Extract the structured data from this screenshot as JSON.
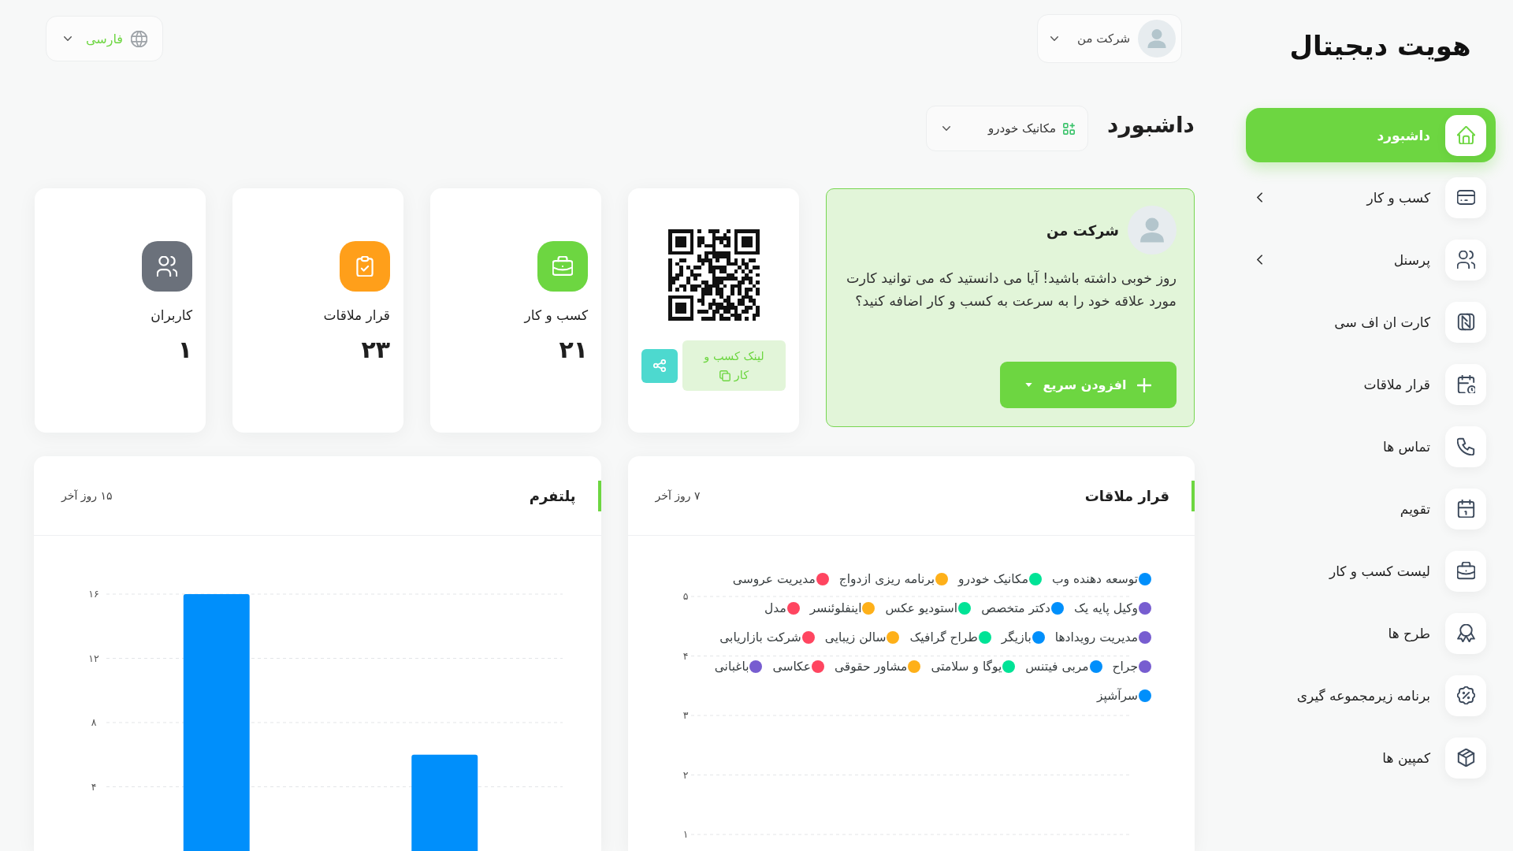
{
  "sidebar": {
    "logo": "هویت دیجیتال",
    "items": [
      {
        "label": "داشبورد",
        "selected": true,
        "kind": "link"
      },
      {
        "label": "کسب و کار",
        "selected": false,
        "kind": "group"
      },
      {
        "label": "پرسنل",
        "selected": false,
        "kind": "group"
      },
      {
        "label": "کارت ان اف سی",
        "selected": false,
        "kind": "link"
      },
      {
        "label": "قرار ملاقات",
        "selected": false,
        "kind": "link"
      },
      {
        "label": "تماس ها",
        "selected": false,
        "kind": "link"
      },
      {
        "label": "تقویم",
        "selected": false,
        "kind": "link"
      },
      {
        "label": "لیست کسب و کار",
        "selected": false,
        "kind": "link"
      },
      {
        "label": "طرح ها",
        "selected": false,
        "kind": "link"
      },
      {
        "label": "برنامه زیرمجموعه گیری",
        "selected": false,
        "kind": "link"
      },
      {
        "label": "کمپین ها",
        "selected": false,
        "kind": "link"
      }
    ]
  },
  "top_bar": {
    "account": {
      "name": "شرکت من"
    },
    "language": {
      "label": "فارسی"
    }
  },
  "page_header": {
    "title": "داشبورد",
    "category": "مکانیک خودرو"
  },
  "welcome_card": {
    "name": "شرکت من",
    "message": "روز خوبی داشته باشید! آیا می دانستید که می توانید کارت مورد علاقه خود را به سرعت به کسب و کار اضافه کنید؟",
    "button": "افزودن سریع"
  },
  "qr_card": {
    "link_label": "لینک کسب و کار"
  },
  "stats": [
    {
      "label": "کسب و کار",
      "value": "۲۱",
      "color": "#6dd641"
    },
    {
      "label": "قرار ملاقات",
      "value": "۲۳",
      "color": "#ff9f1a"
    },
    {
      "label": "کاربران",
      "value": "۱",
      "color": "#6b717b"
    }
  ],
  "charts": [
    {
      "title": "قرار ملاقات",
      "period": "۷ روز آخر",
      "chart_data": {
        "type": "line",
        "grid": true,
        "ylim": [
          1,
          5
        ],
        "yticks": [
          {
            "value": 1,
            "label": "۱"
          },
          {
            "value": 2,
            "label": "۲"
          },
          {
            "value": 3,
            "label": "۳"
          },
          {
            "value": 4,
            "label": "۴"
          },
          {
            "value": 5,
            "label": "۵"
          }
        ],
        "series": [
          {
            "name": "توسعه دهنده وب",
            "color": "#008ffb"
          },
          {
            "name": "مکانیک خودرو",
            "color": "#00e396"
          },
          {
            "name": "برنامه ریزی ازدواج",
            "color": "#feb019"
          },
          {
            "name": "مدیریت عروسی",
            "color": "#ff4560"
          },
          {
            "name": "وکیل پایه یک",
            "color": "#775dd0"
          },
          {
            "name": "دکتر متخصص",
            "color": "#008ffb"
          },
          {
            "name": "استودیو عکس",
            "color": "#00e396"
          },
          {
            "name": "اینفلوئنسر",
            "color": "#feb019"
          },
          {
            "name": "مدل",
            "color": "#ff4560"
          },
          {
            "name": "مدیریت رویدادها",
            "color": "#775dd0"
          },
          {
            "name": "بازیگر",
            "color": "#008ffb"
          },
          {
            "name": "طراح گرافیک",
            "color": "#00e396"
          },
          {
            "name": "سالن زیبایی",
            "color": "#feb019"
          },
          {
            "name": "شرکت بازاریابی",
            "color": "#ff4560"
          },
          {
            "name": "جراح",
            "color": "#775dd0"
          },
          {
            "name": "مربی فیتنس",
            "color": "#008ffb"
          },
          {
            "name": "یوگا و سلامتی",
            "color": "#00e396"
          },
          {
            "name": "مشاور حقوقی",
            "color": "#feb019"
          },
          {
            "name": "عکاسی",
            "color": "#ff4560"
          },
          {
            "name": "باغبانی",
            "color": "#775dd0"
          },
          {
            "name": "سرآشپز",
            "color": "#008ffb"
          }
        ]
      }
    },
    {
      "title": "پلتفرم",
      "period": "۱۵ روز آخر",
      "chart_data": {
        "type": "bar",
        "grid": true,
        "ylim": [
          0,
          16
        ],
        "yticks": [
          {
            "value": 4,
            "label": "۴"
          },
          {
            "value": 8,
            "label": "۸"
          },
          {
            "value": 12,
            "label": "۱۲"
          },
          {
            "value": 16,
            "label": "۱۶"
          }
        ],
        "values": [
          16,
          6
        ]
      }
    }
  ]
}
